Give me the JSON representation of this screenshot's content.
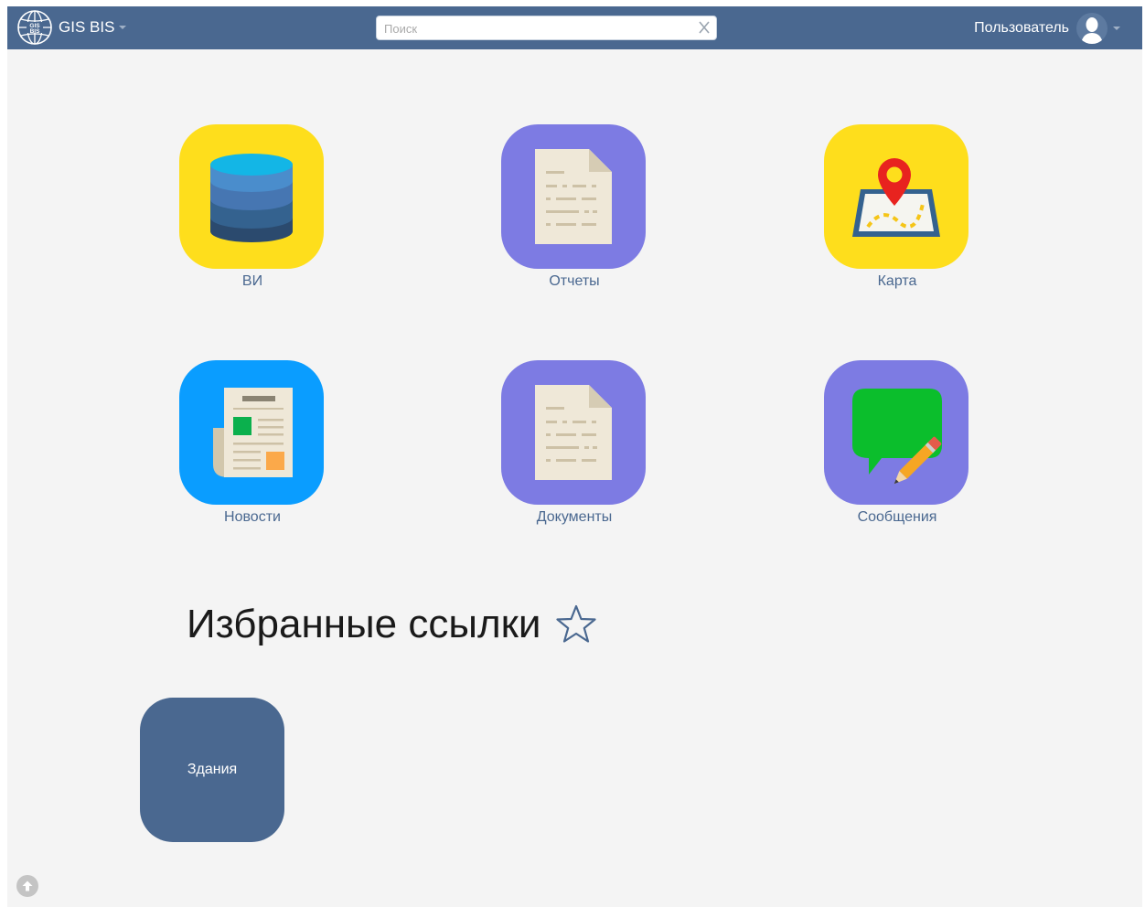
{
  "colors": {
    "navbar": "#4a6890",
    "page_bg": "#f4f4f4",
    "tile_yellow": "#fede1c",
    "tile_purple": "#7d7be3",
    "tile_blue": "#0a9dff",
    "favorite_tile": "#4a6890",
    "label": "#4a6890"
  },
  "header": {
    "brand": "GIS BIS",
    "logo_icon": "globe-gis-logo-icon",
    "search": {
      "placeholder": "Поиск",
      "value": "",
      "clear_icon": "close-icon"
    },
    "user": {
      "name": "Пользователь",
      "avatar_icon": "user-silhouette-icon"
    }
  },
  "apps": [
    {
      "label": "ВИ",
      "icon": "database-icon",
      "color": "#fede1c"
    },
    {
      "label": "Отчеты",
      "icon": "document-icon",
      "color": "#7d7be3"
    },
    {
      "label": "Карта",
      "icon": "map-pin-icon",
      "color": "#fede1c"
    },
    {
      "label": "Новости",
      "icon": "newspaper-icon",
      "color": "#0a9dff"
    },
    {
      "label": "Документы",
      "icon": "document-icon",
      "color": "#7d7be3"
    },
    {
      "label": "Сообщения",
      "icon": "chat-bubble-pencil-icon",
      "color": "#7d7be3"
    }
  ],
  "favorites": {
    "title": "Избранные ссылки",
    "title_icon": "star-outline-icon",
    "items": [
      {
        "label": "Здания"
      }
    ]
  },
  "scroll_top_icon": "arrow-up-circle-icon"
}
